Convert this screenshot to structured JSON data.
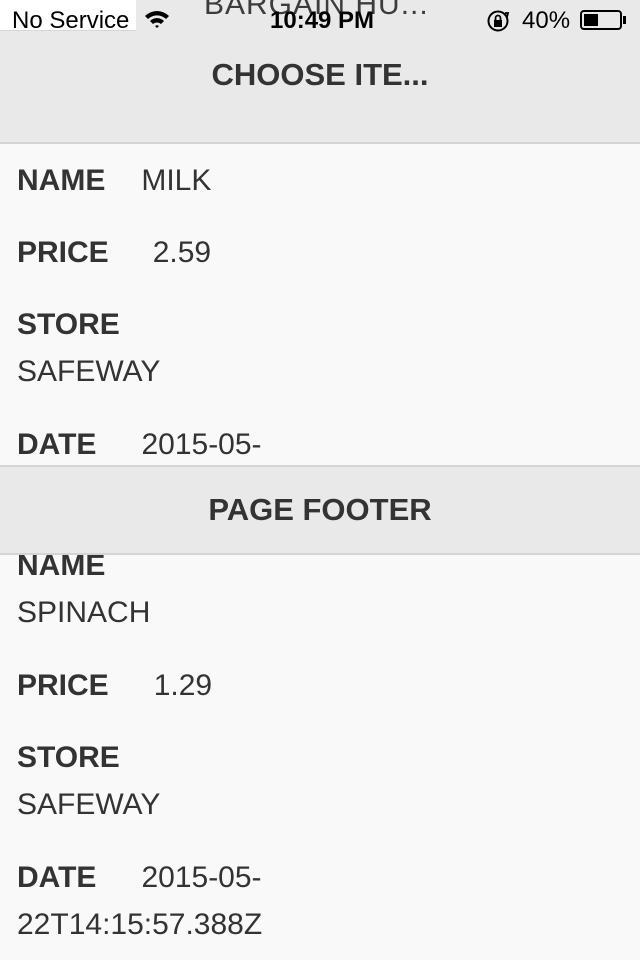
{
  "status_bar": {
    "carrier": "No Service",
    "time": "10:49 PM",
    "battery": "40%",
    "battery_level": 0.4,
    "icons": [
      "wifi-icon",
      "rotation-lock-icon",
      "battery-icon"
    ]
  },
  "background_title": "BARGAIN HU...",
  "header": {
    "title": "CHOOSE ITE..."
  },
  "footer": {
    "title": "PAGE FOOTER"
  },
  "labels": {
    "name": "NAME",
    "price": "PRICE",
    "store": "STORE",
    "date": "DATE"
  },
  "items": [
    {
      "name": "MILK",
      "price": "2.59",
      "store": "SAFEWAY",
      "date_line1": "2015-05-"
    },
    {
      "name": "SPINACH",
      "price": "1.29",
      "store": "SAFEWAY",
      "date_line1": "2015-05-",
      "date_line2": "22T14:15:57.388Z"
    }
  ],
  "colors": {
    "bar_background": "#e9e9e9",
    "page_background": "#f9f9f9",
    "text": "#333333"
  }
}
